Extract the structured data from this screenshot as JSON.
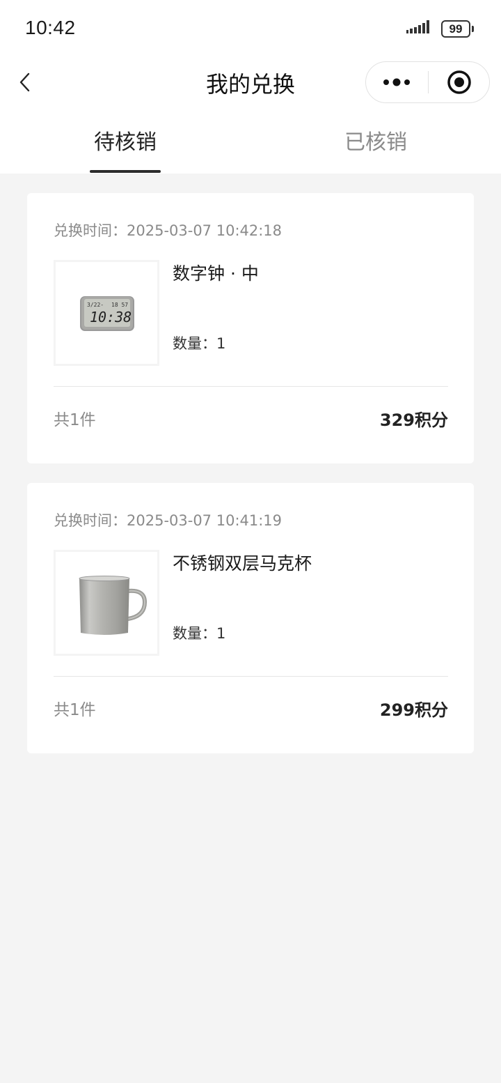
{
  "status_bar": {
    "time": "10:42",
    "battery_level": "99"
  },
  "nav": {
    "title": "我的兑换"
  },
  "tabs": [
    {
      "label": "待核销",
      "active": true
    },
    {
      "label": "已核销",
      "active": false
    }
  ],
  "orders": [
    {
      "time_label": "兑换时间：",
      "time": "2025-03-07 10:42:18",
      "product_name": "数字钟 · 中",
      "qty_label": "数量：",
      "qty": "1",
      "count_text": "共1件",
      "points_text": "329积分",
      "image": "digital-clock",
      "clock_display": {
        "date": "3/22-",
        "seconds": "18 57",
        "time": "10:38"
      }
    },
    {
      "time_label": "兑换时间：",
      "time": "2025-03-07 10:41:19",
      "product_name": "不锈钢双层马克杯",
      "qty_label": "数量：",
      "qty": "1",
      "count_text": "共1件",
      "points_text": "299积分",
      "image": "steel-mug"
    }
  ],
  "colors": {
    "page_bg": "#f4f4f4",
    "card_bg": "#ffffff",
    "muted_text": "#8a8a8a",
    "tab_underline": "#2b2b2b"
  }
}
